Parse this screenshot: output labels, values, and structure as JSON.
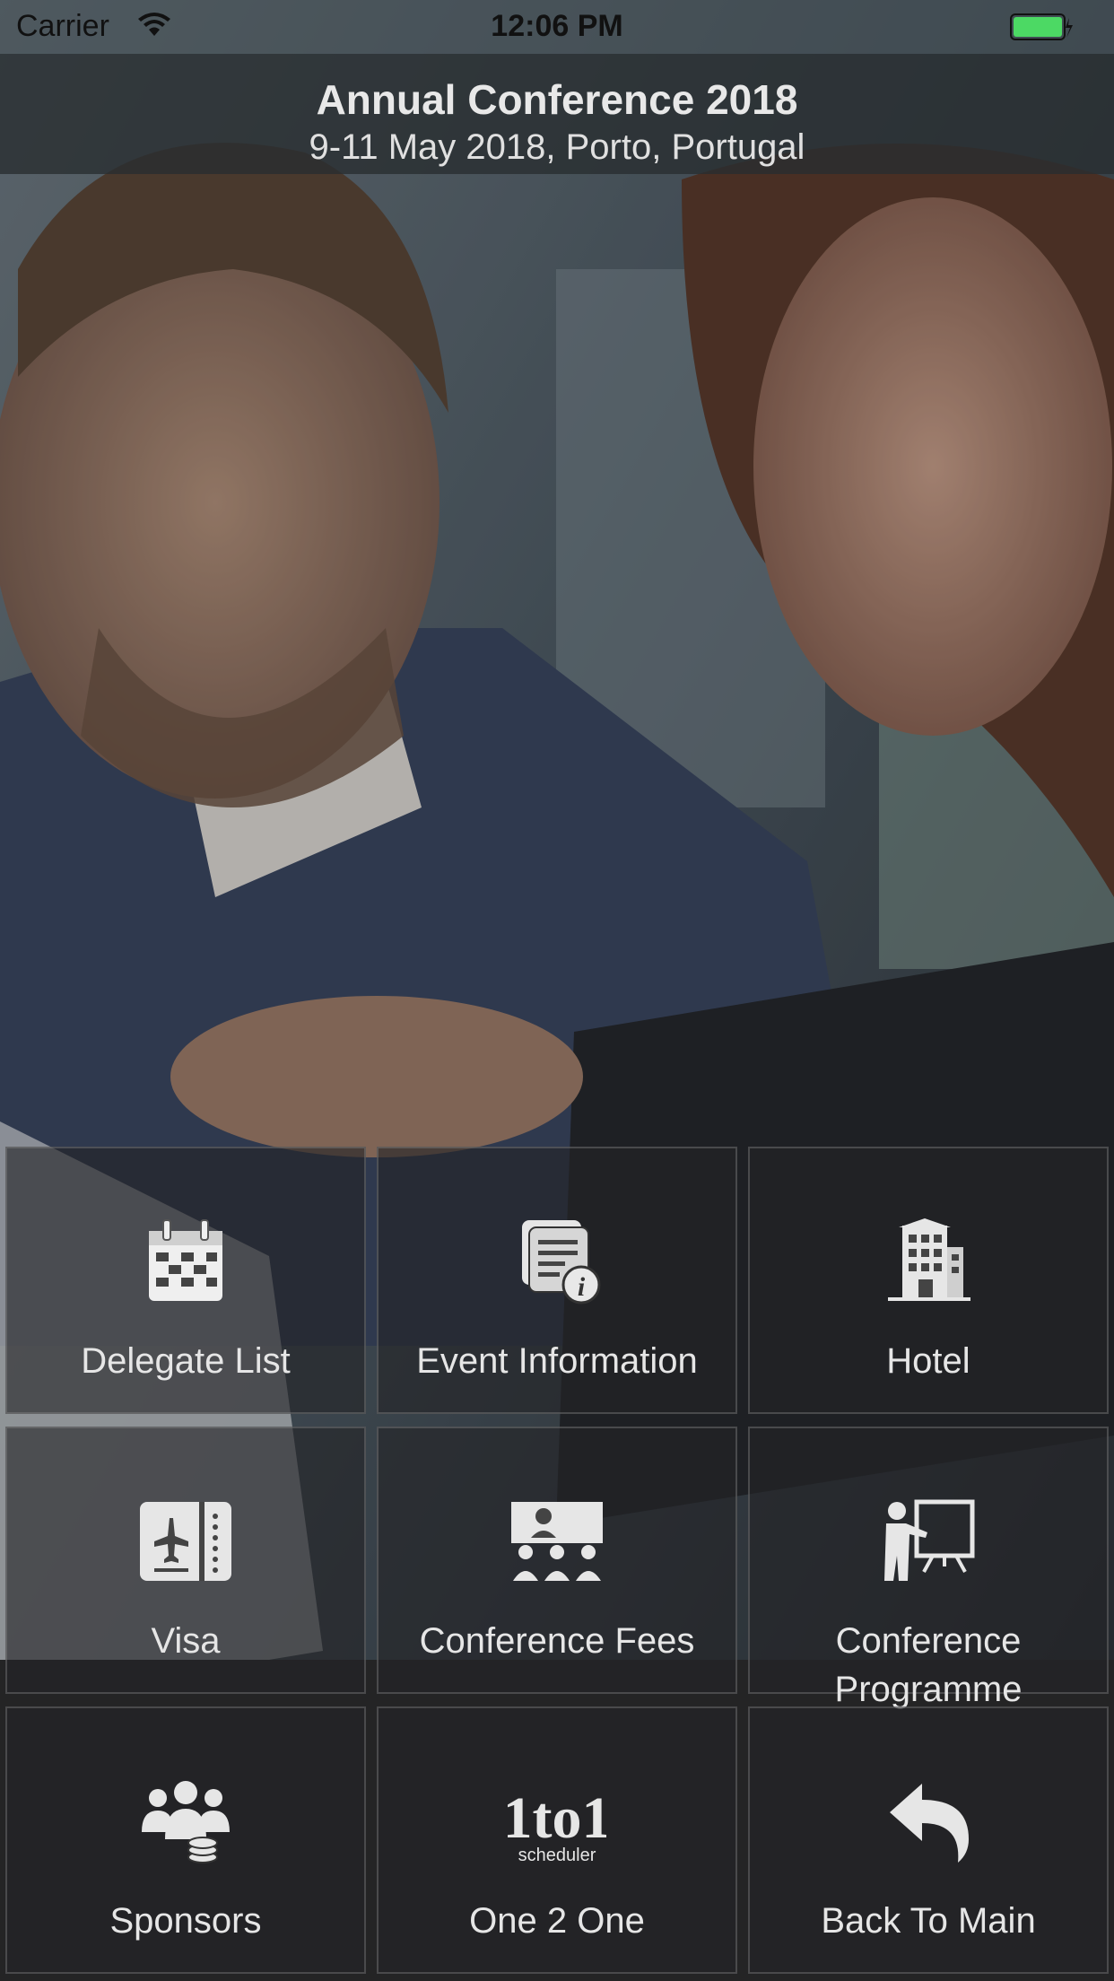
{
  "status_bar": {
    "carrier": "Carrier",
    "time": "12:06 PM",
    "battery_color": "#4cd964"
  },
  "header": {
    "title": "Annual Conference 2018",
    "subtitle": "9-11 May 2018, Porto, Portugal"
  },
  "menu": {
    "items": [
      {
        "label": "Delegate List",
        "icon": "calendar-icon"
      },
      {
        "label": "Event Information",
        "icon": "info-document-icon"
      },
      {
        "label": "Hotel",
        "icon": "hotel-building-icon"
      },
      {
        "label": "Visa",
        "icon": "passport-icon"
      },
      {
        "label": "Conference Fees",
        "icon": "audience-presentation-icon"
      },
      {
        "label": "Conference\nProgramme",
        "label_line1": "Conference",
        "label_line2": "Programme",
        "icon": "presenter-board-icon"
      },
      {
        "label": "Sponsors",
        "icon": "sponsors-group-coins-icon"
      },
      {
        "label": "One 2 One",
        "icon": "one-to-one-scheduler-icon",
        "icon_text_main": "1to1",
        "icon_text_sub": "scheduler"
      },
      {
        "label": "Back To Main",
        "icon": "back-arrow-icon"
      }
    ]
  },
  "colors": {
    "header_bg": "#282d30",
    "tile_bg": "#232426",
    "text": "#e6e6e6"
  }
}
